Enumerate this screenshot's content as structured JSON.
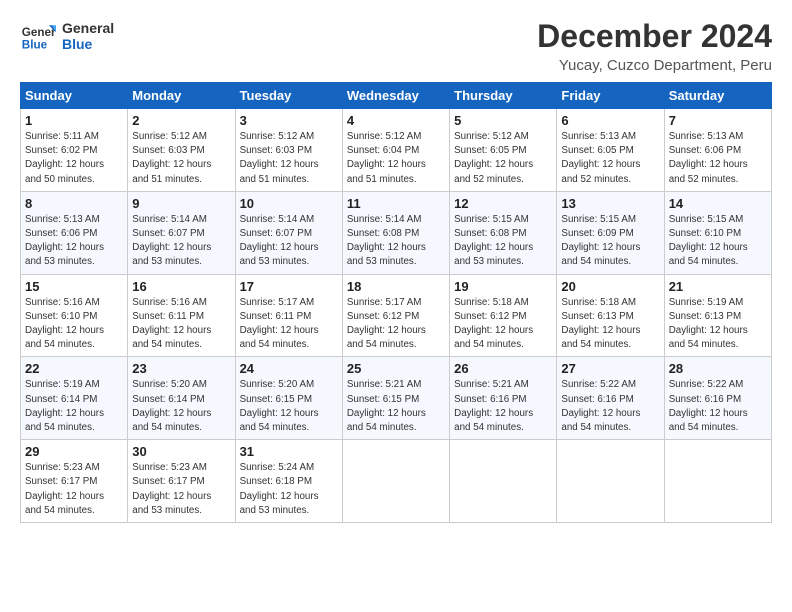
{
  "logo": {
    "line1": "General",
    "line2": "Blue"
  },
  "title": "December 2024",
  "subtitle": "Yucay, Cuzco Department, Peru",
  "weekdays": [
    "Sunday",
    "Monday",
    "Tuesday",
    "Wednesday",
    "Thursday",
    "Friday",
    "Saturday"
  ],
  "weeks": [
    [
      {
        "day": "1",
        "info": "Sunrise: 5:11 AM\nSunset: 6:02 PM\nDaylight: 12 hours\nand 50 minutes."
      },
      {
        "day": "2",
        "info": "Sunrise: 5:12 AM\nSunset: 6:03 PM\nDaylight: 12 hours\nand 51 minutes."
      },
      {
        "day": "3",
        "info": "Sunrise: 5:12 AM\nSunset: 6:03 PM\nDaylight: 12 hours\nand 51 minutes."
      },
      {
        "day": "4",
        "info": "Sunrise: 5:12 AM\nSunset: 6:04 PM\nDaylight: 12 hours\nand 51 minutes."
      },
      {
        "day": "5",
        "info": "Sunrise: 5:12 AM\nSunset: 6:05 PM\nDaylight: 12 hours\nand 52 minutes."
      },
      {
        "day": "6",
        "info": "Sunrise: 5:13 AM\nSunset: 6:05 PM\nDaylight: 12 hours\nand 52 minutes."
      },
      {
        "day": "7",
        "info": "Sunrise: 5:13 AM\nSunset: 6:06 PM\nDaylight: 12 hours\nand 52 minutes."
      }
    ],
    [
      {
        "day": "8",
        "info": "Sunrise: 5:13 AM\nSunset: 6:06 PM\nDaylight: 12 hours\nand 53 minutes."
      },
      {
        "day": "9",
        "info": "Sunrise: 5:14 AM\nSunset: 6:07 PM\nDaylight: 12 hours\nand 53 minutes."
      },
      {
        "day": "10",
        "info": "Sunrise: 5:14 AM\nSunset: 6:07 PM\nDaylight: 12 hours\nand 53 minutes."
      },
      {
        "day": "11",
        "info": "Sunrise: 5:14 AM\nSunset: 6:08 PM\nDaylight: 12 hours\nand 53 minutes."
      },
      {
        "day": "12",
        "info": "Sunrise: 5:15 AM\nSunset: 6:08 PM\nDaylight: 12 hours\nand 53 minutes."
      },
      {
        "day": "13",
        "info": "Sunrise: 5:15 AM\nSunset: 6:09 PM\nDaylight: 12 hours\nand 54 minutes."
      },
      {
        "day": "14",
        "info": "Sunrise: 5:15 AM\nSunset: 6:10 PM\nDaylight: 12 hours\nand 54 minutes."
      }
    ],
    [
      {
        "day": "15",
        "info": "Sunrise: 5:16 AM\nSunset: 6:10 PM\nDaylight: 12 hours\nand 54 minutes."
      },
      {
        "day": "16",
        "info": "Sunrise: 5:16 AM\nSunset: 6:11 PM\nDaylight: 12 hours\nand 54 minutes."
      },
      {
        "day": "17",
        "info": "Sunrise: 5:17 AM\nSunset: 6:11 PM\nDaylight: 12 hours\nand 54 minutes."
      },
      {
        "day": "18",
        "info": "Sunrise: 5:17 AM\nSunset: 6:12 PM\nDaylight: 12 hours\nand 54 minutes."
      },
      {
        "day": "19",
        "info": "Sunrise: 5:18 AM\nSunset: 6:12 PM\nDaylight: 12 hours\nand 54 minutes."
      },
      {
        "day": "20",
        "info": "Sunrise: 5:18 AM\nSunset: 6:13 PM\nDaylight: 12 hours\nand 54 minutes."
      },
      {
        "day": "21",
        "info": "Sunrise: 5:19 AM\nSunset: 6:13 PM\nDaylight: 12 hours\nand 54 minutes."
      }
    ],
    [
      {
        "day": "22",
        "info": "Sunrise: 5:19 AM\nSunset: 6:14 PM\nDaylight: 12 hours\nand 54 minutes."
      },
      {
        "day": "23",
        "info": "Sunrise: 5:20 AM\nSunset: 6:14 PM\nDaylight: 12 hours\nand 54 minutes."
      },
      {
        "day": "24",
        "info": "Sunrise: 5:20 AM\nSunset: 6:15 PM\nDaylight: 12 hours\nand 54 minutes."
      },
      {
        "day": "25",
        "info": "Sunrise: 5:21 AM\nSunset: 6:15 PM\nDaylight: 12 hours\nand 54 minutes."
      },
      {
        "day": "26",
        "info": "Sunrise: 5:21 AM\nSunset: 6:16 PM\nDaylight: 12 hours\nand 54 minutes."
      },
      {
        "day": "27",
        "info": "Sunrise: 5:22 AM\nSunset: 6:16 PM\nDaylight: 12 hours\nand 54 minutes."
      },
      {
        "day": "28",
        "info": "Sunrise: 5:22 AM\nSunset: 6:16 PM\nDaylight: 12 hours\nand 54 minutes."
      }
    ],
    [
      {
        "day": "29",
        "info": "Sunrise: 5:23 AM\nSunset: 6:17 PM\nDaylight: 12 hours\nand 54 minutes."
      },
      {
        "day": "30",
        "info": "Sunrise: 5:23 AM\nSunset: 6:17 PM\nDaylight: 12 hours\nand 53 minutes."
      },
      {
        "day": "31",
        "info": "Sunrise: 5:24 AM\nSunset: 6:18 PM\nDaylight: 12 hours\nand 53 minutes."
      },
      null,
      null,
      null,
      null
    ]
  ]
}
